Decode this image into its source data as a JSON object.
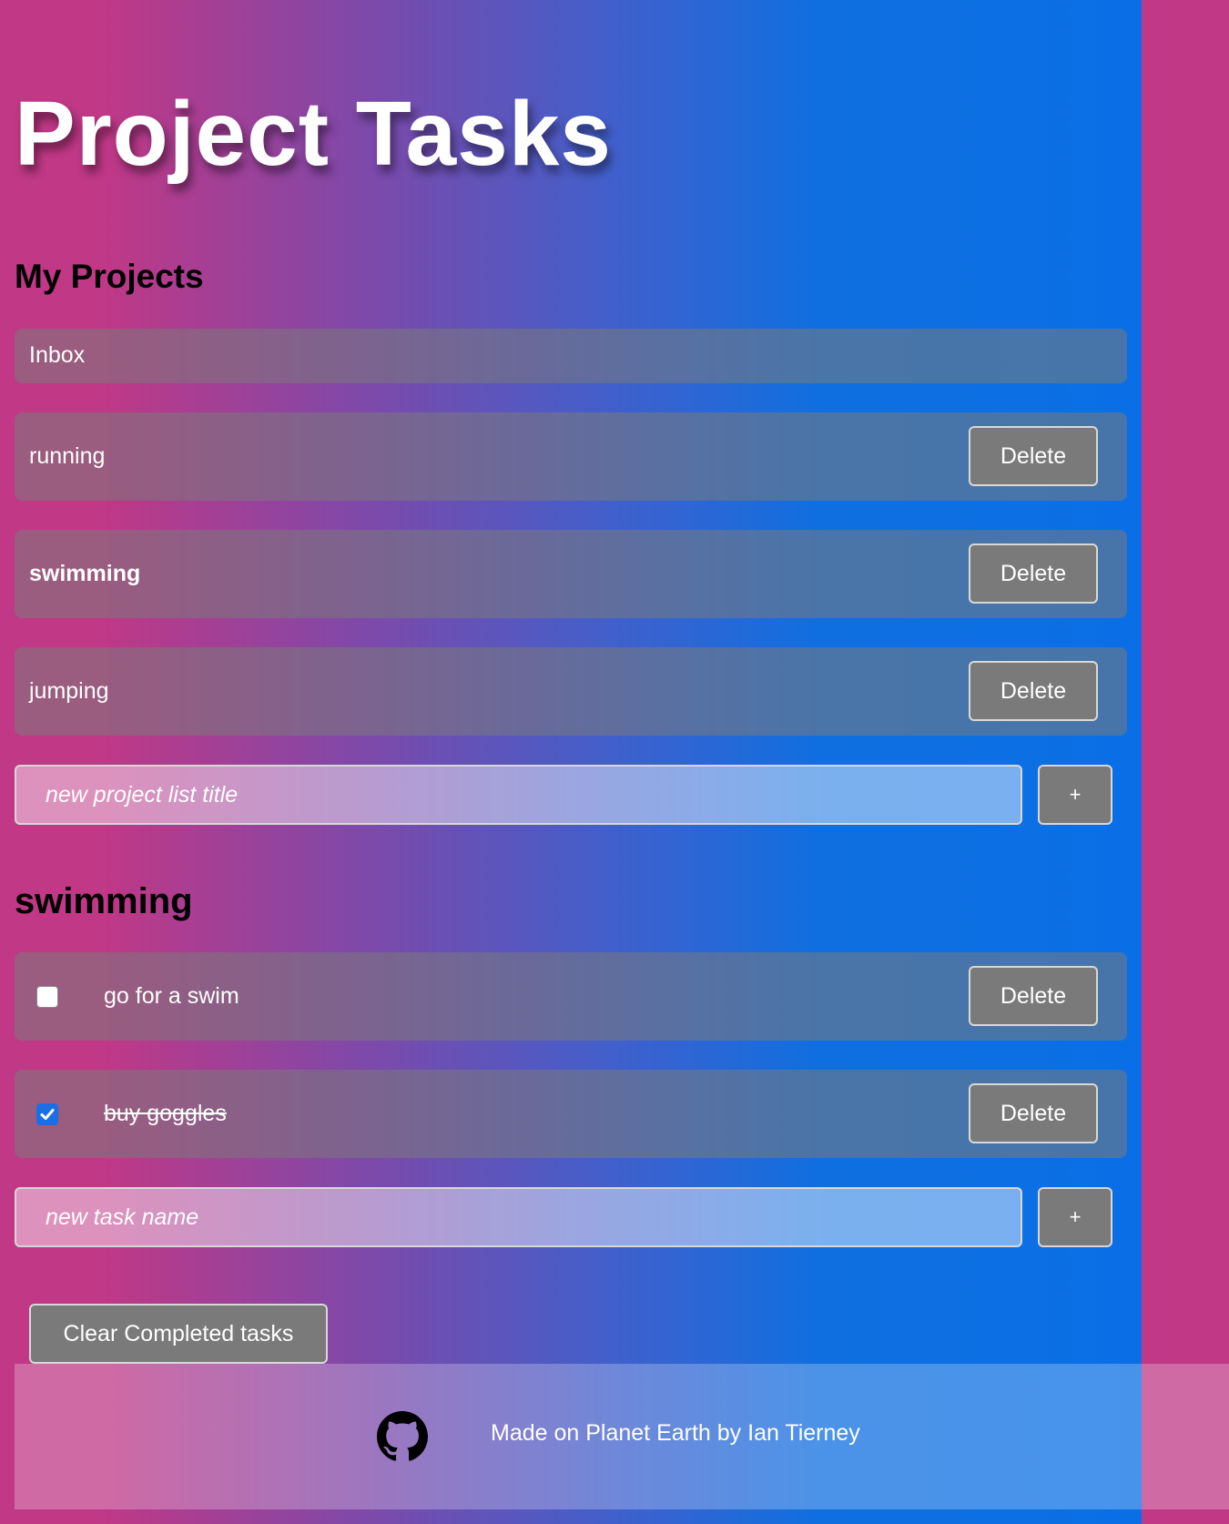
{
  "header": {
    "title": "Project Tasks"
  },
  "projects": {
    "heading": "My Projects",
    "items": [
      {
        "label": "Inbox",
        "bold": false,
        "deletable": false
      },
      {
        "label": "running",
        "bold": false,
        "deletable": true
      },
      {
        "label": "swimming",
        "bold": true,
        "deletable": true
      },
      {
        "label": "jumping",
        "bold": false,
        "deletable": true
      }
    ],
    "delete_label": "Delete",
    "new_placeholder": "new project list title",
    "add_label": "+"
  },
  "tasks": {
    "heading": "swimming",
    "items": [
      {
        "label": "go for a swim",
        "done": false
      },
      {
        "label": "buy goggles",
        "done": true
      }
    ],
    "delete_label": "Delete",
    "new_placeholder": "new task name",
    "add_label": "+",
    "clear_label": "Clear Completed tasks"
  },
  "footer": {
    "text": "Made on Planet Earth by Ian Tierney",
    "icon": "github-icon"
  }
}
